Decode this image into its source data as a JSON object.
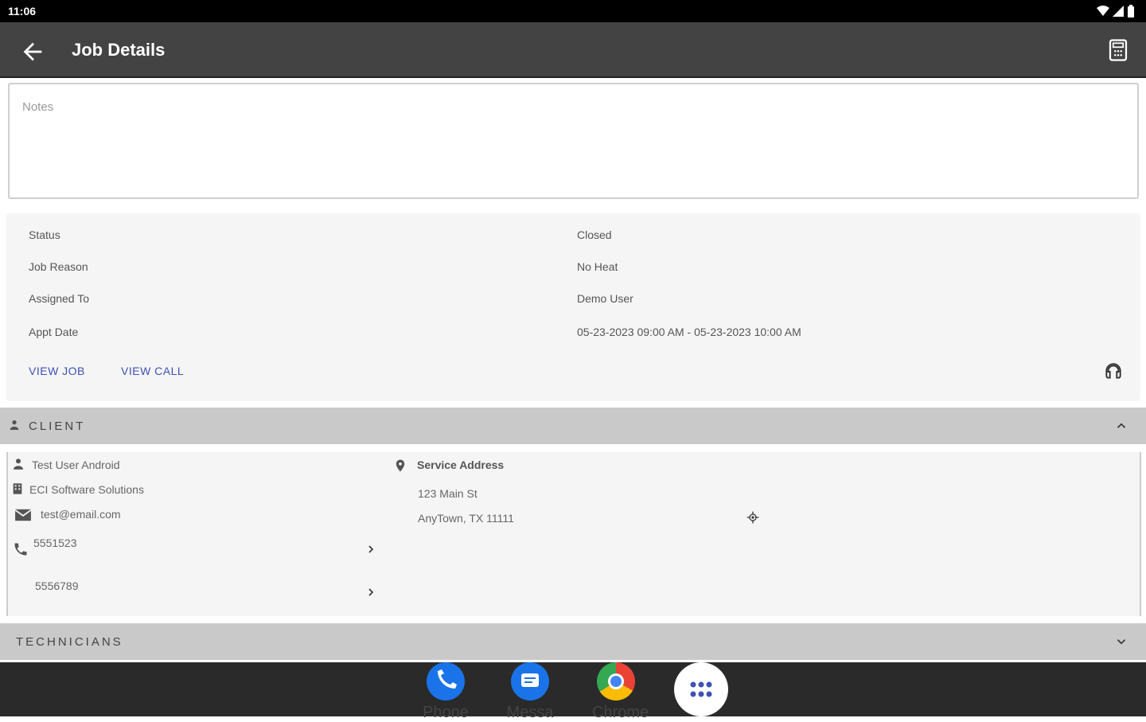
{
  "status_bar": {
    "time": "11:06"
  },
  "appbar": {
    "title": "Job Details"
  },
  "notes": {
    "placeholder": "Notes"
  },
  "details": {
    "rows": [
      {
        "label": "Status",
        "value": "Closed"
      },
      {
        "label": "Job Reason",
        "value": "No Heat"
      },
      {
        "label": "Assigned To",
        "value": "Demo User"
      },
      {
        "label": "Appt Date",
        "value": "05-23-2023 09:00 AM - 05-23-2023 10:00 AM"
      }
    ],
    "view_job": "VIEW JOB",
    "view_call": "VIEW CALL"
  },
  "client_section": {
    "title": "CLIENT",
    "name": "Test User Android",
    "company": "ECI Software Solutions",
    "email": "test@email.com",
    "phones": [
      "5551523",
      "5556789"
    ],
    "service_address_label": "Service Address",
    "address_line1": "123 Main St",
    "address_line2": "AnyTown, TX 11111"
  },
  "technicians_section": {
    "title": "TECHNICIANS"
  },
  "dock": {
    "items": [
      {
        "label": "Phone",
        "color": "#1a73e8"
      },
      {
        "label": "Messa",
        "color": "#1a73e8"
      },
      {
        "label": "Chrome",
        "color": "#ffffff"
      }
    ]
  }
}
